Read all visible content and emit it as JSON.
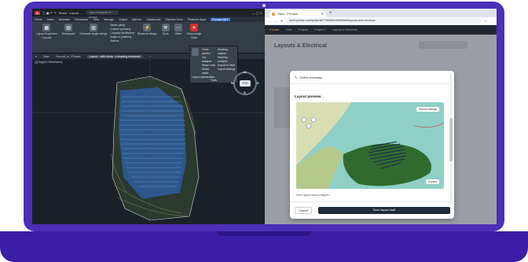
{
  "cad": {
    "app_badge": "A",
    "share_label": "Share",
    "layout_label": "Layout -...",
    "search_placeholder": "Type a keyword or phrase",
    "menus": [
      "Home",
      "Insert",
      "Annotate",
      "Parametric",
      "View",
      "Manage",
      "Output",
      "Add-ins",
      "Collaborate",
      "Express Tools",
      "Featured Apps",
      "PVcase BET"
    ],
    "active_menu": "PVcase BET",
    "ribbon": {
      "layout_properties": "Layout Properties",
      "layouts_group": "Layouts",
      "workspace": "Workspace",
      "generate_strings": "Generate single strings",
      "string_items": [
        "Series piling",
        "Custom grouping",
        "Capacity distribution",
        "Adapt to positions",
        "Actions"
      ],
      "electrical_design": "Electrical design",
      "tools": "Tools",
      "other": "Other",
      "close_plugin": "Close plugin",
      "close": "Close"
    },
    "doc_tabs": [
      "Start",
      "Convert_to_PVcase",
      "Layout - with electr...d shading elements*"
    ],
    "active_doc_tab": "Layout - with electr...d shading elements*",
    "viewport_label": "[-][Top][2D Wireframe]",
    "dropdown": {
      "header": "Layout optimization",
      "items_left": [
        "Trace section",
        "Cut analysis",
        "Share road",
        "Route mesh"
      ],
      "items_right": [
        "Shading objects",
        "Shading analysis",
        "Export to Yield",
        "Import settings"
      ],
      "footer": "Tools"
    },
    "compass": {
      "top": "TOP",
      "n": "N",
      "s": "S",
      "w": "W",
      "e": "E"
    }
  },
  "browser": {
    "tab_title": "Yield - PVcase",
    "new_tab": "+",
    "url": "yield.pvcase.com/projects/77369962/6f390b80/layouts-and-electrical",
    "app_nav": [
      "PVcase",
      "Yield",
      "Projects",
      "Project X",
      "Layouts & Electrical"
    ],
    "page_heading": "Layouts & Electrical",
    "modal": {
      "define_manually": "Define manually",
      "section_title": "Layout preview",
      "preview_settings": "Preview settings",
      "expand": "Expand",
      "partial_text": "Save layout and configure...",
      "cancel": "Cancel",
      "save": "Save layout draft"
    }
  }
}
